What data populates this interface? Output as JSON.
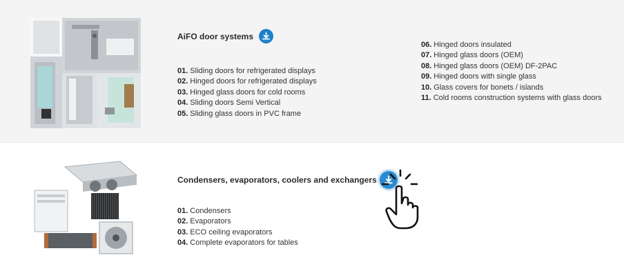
{
  "sections": [
    {
      "title": "AiFO door systems",
      "col1": [
        {
          "num": "01.",
          "text": "Sliding doors for refrigerated displays"
        },
        {
          "num": "02.",
          "text": "Hinged doors for refrigerated displays"
        },
        {
          "num": "03.",
          "text": "Hinged glass doors for cold rooms"
        },
        {
          "num": "04.",
          "text": "Sliding doors Semi Vertical"
        },
        {
          "num": "05.",
          "text": "Sliding glass doors in PVC frame"
        }
      ],
      "col2": [
        {
          "num": "06.",
          "text": "Hinged doors insulated"
        },
        {
          "num": "07.",
          "text": "Hinged glass doors (OEM)"
        },
        {
          "num": "08.",
          "text": "Hinged glass doors (OEM) DF-2PAC"
        },
        {
          "num": "09.",
          "text": "Hinged doors with single glass"
        },
        {
          "num": "10.",
          "text": "Glass covers for bonets / islands"
        },
        {
          "num": "11.",
          "text": "Cold rooms construction systems with glass doors"
        }
      ]
    },
    {
      "title": "Condensers, evaporators, coolers and exchangers",
      "col1": [
        {
          "num": "01.",
          "text": "Condensers"
        },
        {
          "num": "02.",
          "text": "Evaporators"
        },
        {
          "num": "03.",
          "text": "ECO ceiling evaporators"
        },
        {
          "num": "04.",
          "text": "Complete evaporators for tables"
        }
      ]
    }
  ],
  "icons": {
    "download": "download-icon",
    "cursor": "pointer-hand-cursor"
  },
  "colors": {
    "accent": "#1e82c8",
    "section_bg": "#f4f4f4"
  }
}
